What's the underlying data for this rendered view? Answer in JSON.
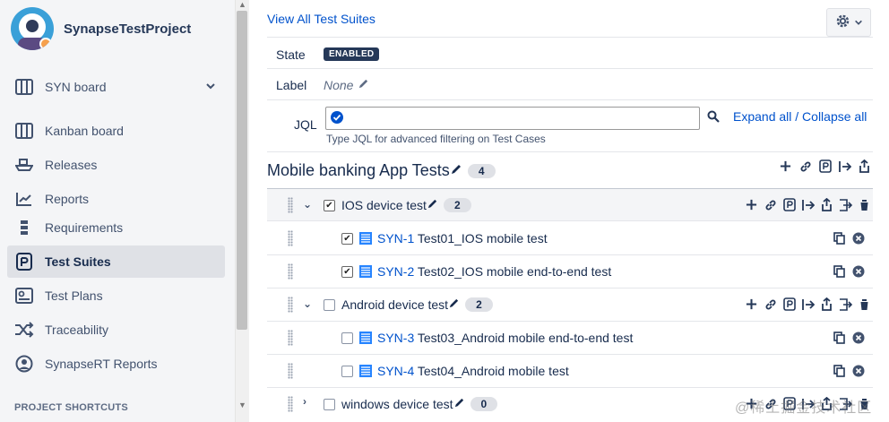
{
  "project": {
    "name": "SynapseTestProject"
  },
  "sidebar": {
    "board": {
      "label": "SYN board"
    },
    "items": [
      {
        "label": "Kanban board",
        "icon": "kanban-icon"
      },
      {
        "label": "Releases",
        "icon": "ship-icon"
      },
      {
        "label": "Reports",
        "icon": "chart-line-icon"
      },
      {
        "label": "Requirements",
        "icon": "requirements-icon"
      },
      {
        "label": "Test Suites",
        "icon": "test-suites-icon",
        "active": true
      },
      {
        "label": "Test Plans",
        "icon": "test-plans-icon"
      },
      {
        "label": "Traceability",
        "icon": "shuffle-icon"
      },
      {
        "label": "SynapseRT Reports",
        "icon": "synapse-reports-icon"
      }
    ],
    "shortcuts_label": "PROJECT SHORTCUTS"
  },
  "main": {
    "view_all": "View All Test Suites",
    "state": {
      "label": "State",
      "value": "ENABLED"
    },
    "label_field": {
      "label": "Label",
      "value": "None"
    },
    "jql": {
      "label": "JQL",
      "value": "",
      "help": "Type JQL for advanced filtering on Test Cases",
      "expand": "Expand all / Collapse all"
    },
    "suite": {
      "title": "Mobile banking App Tests",
      "count": "4"
    },
    "rows": [
      {
        "type": "group",
        "name": "IOS device test",
        "count": "2",
        "checked": true,
        "expanded": true
      },
      {
        "type": "case",
        "key": "SYN-1",
        "name": "Test01_IOS mobile test",
        "checked": true
      },
      {
        "type": "case",
        "key": "SYN-2",
        "name": "Test02_IOS mobile end-to-end test",
        "checked": true
      },
      {
        "type": "group",
        "name": "Android device test",
        "count": "2",
        "checked": false,
        "expanded": true
      },
      {
        "type": "case",
        "key": "SYN-3",
        "name": "Test03_Android mobile end-to-end test",
        "checked": false
      },
      {
        "type": "case",
        "key": "SYN-4",
        "name": "Test04_Android mobile test",
        "checked": false
      },
      {
        "type": "group",
        "name": "windows device test",
        "count": "0",
        "checked": false,
        "expanded": false
      }
    ]
  },
  "watermark": "@稀土掘金技术社区",
  "colors": {
    "accent": "#0052cc",
    "sidebar_bg": "#f4f5f7",
    "lozenge": "#253858"
  }
}
